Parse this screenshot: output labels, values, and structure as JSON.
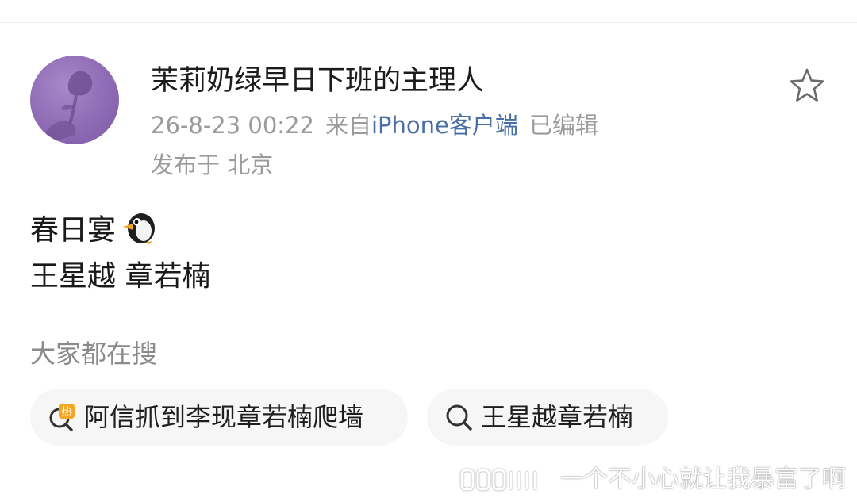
{
  "post": {
    "author_name": "茉莉奶绿早日下班的主理人",
    "timestamp": "26-8-23 00:22",
    "source_prefix": "来自",
    "source": "iPhone客户端",
    "edited": "已编辑",
    "location": "发布于 北京",
    "body_lines": [
      "春日宴",
      "王星越 章若楠"
    ],
    "emoji": "penguin-emoji"
  },
  "actions": {
    "favorite_icon": "star-icon"
  },
  "search": {
    "title": "大家都在搜",
    "items": [
      {
        "label": "阿信抓到李现章若楠爬墙",
        "icon": "hot-search-icon",
        "badge": "热"
      },
      {
        "label": "王星越章若楠",
        "icon": "search-icon"
      }
    ]
  },
  "watermark": {
    "text": "一个不小心就让我暴富了啊",
    "logo": "weibo-watermark-logo"
  },
  "colors": {
    "link": "#4a6fa5",
    "meta_gray": "#9b9b9b",
    "hot_badge": "#f5a623",
    "chip_bg": "#f6f6f6"
  }
}
